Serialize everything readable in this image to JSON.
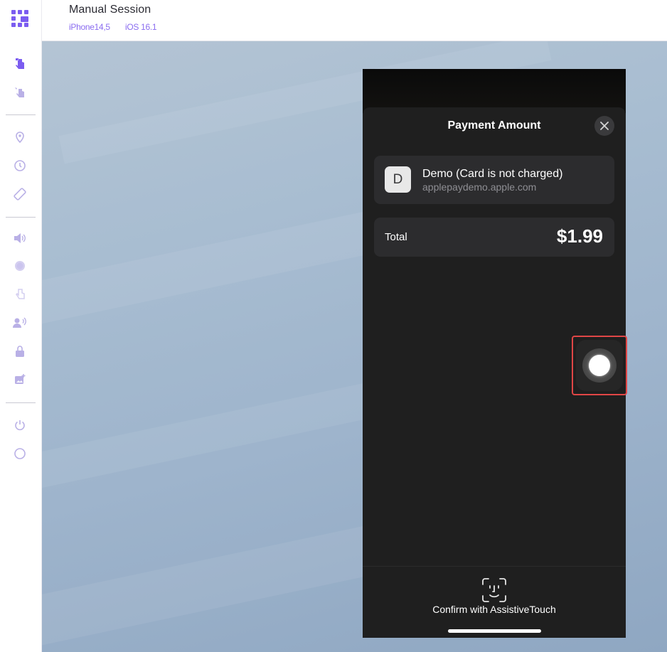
{
  "header": {
    "title": "Manual Session",
    "device": "iPhone14,5",
    "os": "iOS 16.1"
  },
  "sidebar": {
    "icons": [
      "touch-icon",
      "gesture-icon",
      "location-icon",
      "clock-icon",
      "rotate-icon",
      "volume-icon",
      "settings-gear-icon",
      "hand-icon",
      "voice-user-icon",
      "lock-icon",
      "image-add-icon",
      "power-icon",
      "home-circle-icon"
    ]
  },
  "payment_sheet": {
    "title": "Payment Amount",
    "merchant_initial": "D",
    "merchant_name": "Demo (Card is not charged)",
    "merchant_url": "applepaydemo.apple.com",
    "total_label": "Total",
    "total_amount": "$1.99",
    "confirm_text": "Confirm with AssistiveTouch"
  },
  "colors": {
    "accent": "#7b5cf0",
    "highlight": "#e04646",
    "sheet_bg": "#1f1f1f"
  }
}
